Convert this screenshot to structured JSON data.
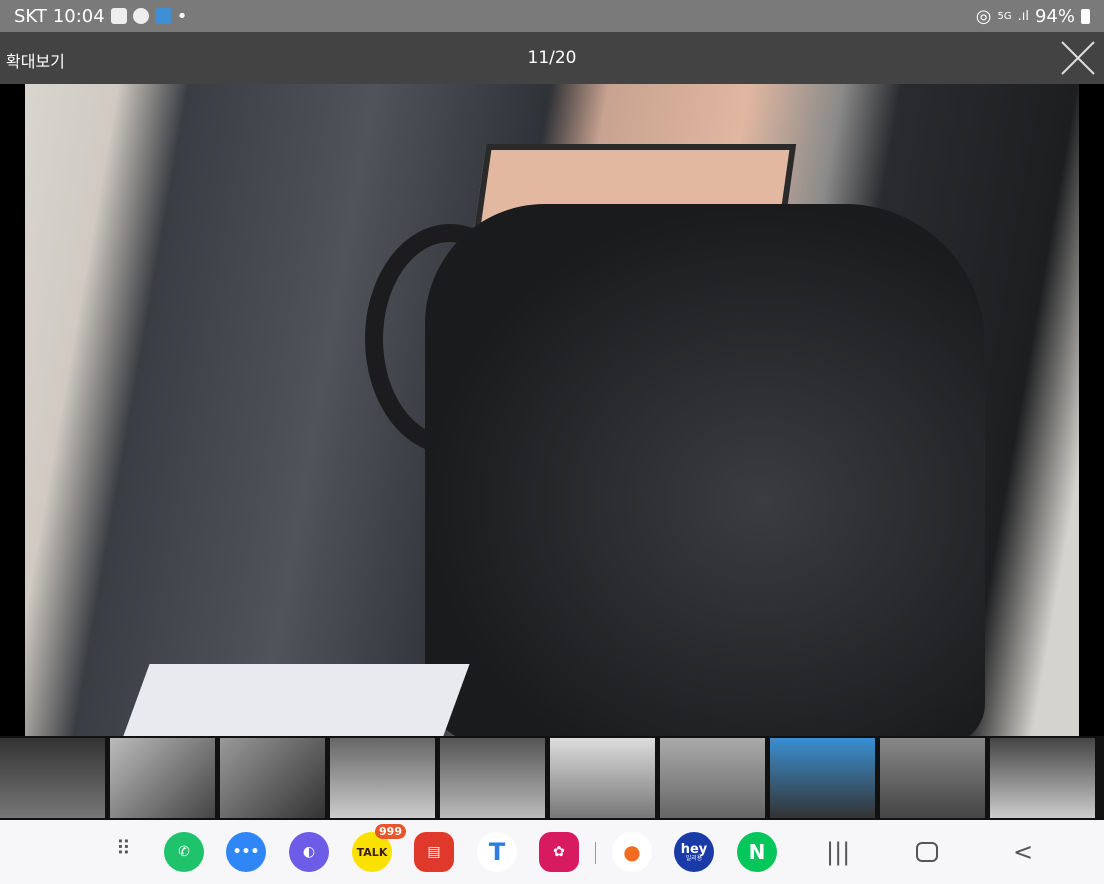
{
  "status_bar": {
    "carrier": "SKT",
    "time": "10:04",
    "battery": "94%",
    "network": "5G",
    "notification_icons": [
      "gallery-icon",
      "kakaotalk-icon",
      "app-icon"
    ]
  },
  "viewer": {
    "zoom_label": "확대보기",
    "counter": "11/20",
    "current_index": 11,
    "total": 20
  },
  "thumbnails": {
    "count_visible": 11
  },
  "dock": {
    "apps": [
      {
        "name": "phone",
        "color": "#1ec36b"
      },
      {
        "name": "messages",
        "color": "#2f86f6"
      },
      {
        "name": "internet",
        "color": "#6c5ce7"
      },
      {
        "name": "kakaotalk",
        "label": "TALK",
        "badge": "999",
        "color": "#fae100"
      },
      {
        "name": "notes",
        "color": "#e0392b"
      },
      {
        "name": "t-app",
        "label": "T",
        "color": "#ffffff"
      },
      {
        "name": "flower",
        "color": "#d81b60"
      },
      {
        "name": "carrot",
        "color": "#ffffff"
      },
      {
        "name": "hey",
        "label": "hey",
        "sublabel": "일리용",
        "color": "#1a3aa8"
      },
      {
        "name": "naver",
        "label": "N",
        "color": "#03c75a"
      }
    ],
    "nav": {
      "recents": "|||",
      "home": "○",
      "back": "<"
    }
  }
}
